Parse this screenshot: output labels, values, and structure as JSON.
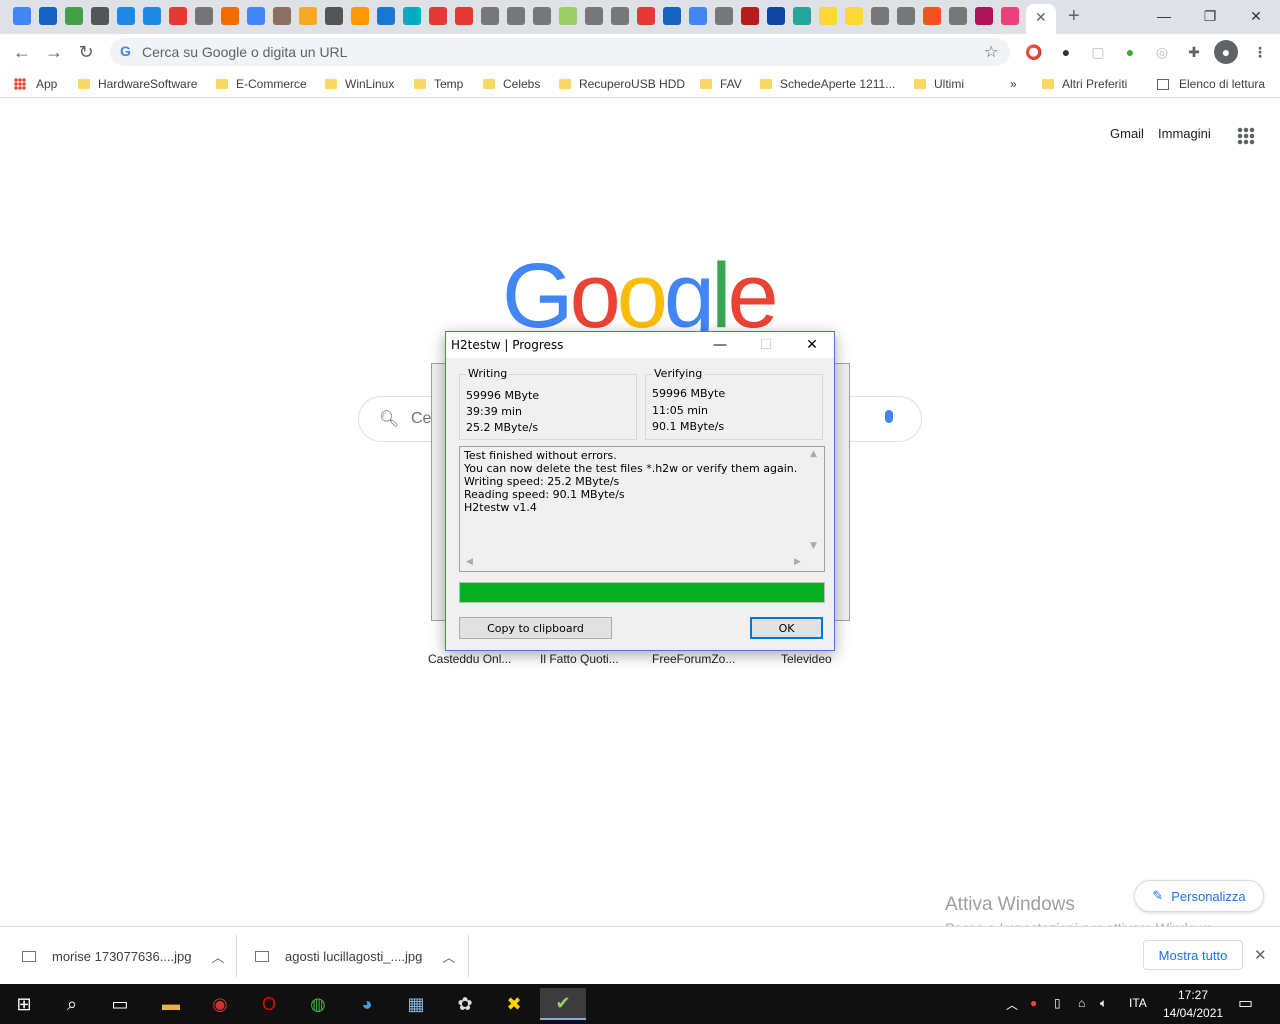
{
  "browser": {
    "omnibox_placeholder": "Cerca su Google o digita un URL",
    "bookmarks": [
      {
        "label": "App",
        "type": "apps"
      },
      {
        "label": "HardwareSoftware",
        "type": "folder"
      },
      {
        "label": "E-Commerce",
        "type": "folder"
      },
      {
        "label": "WinLinux",
        "type": "folder"
      },
      {
        "label": "Temp",
        "type": "folder"
      },
      {
        "label": "Celebs",
        "type": "folder"
      },
      {
        "label": "RecuperoUSB HDD",
        "type": "folder"
      },
      {
        "label": "FAV",
        "type": "folder"
      },
      {
        "label": "SchedeAperte 1211...",
        "type": "folder"
      },
      {
        "label": "Ultimi",
        "type": "folder"
      }
    ],
    "bookmarks_overflow": "»",
    "other_bookmarks": "Altri Preferiti",
    "reading_list": "Elenco di lettura"
  },
  "google": {
    "gmail": "Gmail",
    "images": "Immagini",
    "search_partial": "Ce",
    "shortcuts": [
      "Casteddu Onl...",
      "Il Fatto Quoti...",
      "FreeForumZo...",
      "Televideo"
    ],
    "personalize": "Personalizza"
  },
  "watermark": {
    "line1": "Attiva Windows",
    "line2": "Passa a Impostazioni per attivare Windows."
  },
  "downloads": {
    "items": [
      "morise 173077636....jpg",
      "agosti lucillagosti_....jpg"
    ],
    "show_all": "Mostra tutto"
  },
  "dialog": {
    "title": "H2testw | Progress",
    "writing": {
      "title": "Writing",
      "size": "59996 MByte",
      "time": "39:39 min",
      "speed": "25.2 MByte/s"
    },
    "verifying": {
      "title": "Verifying",
      "size": "59996 MByte",
      "time": "11:05 min",
      "speed": "90.1 MByte/s"
    },
    "log": [
      "Test finished without errors.",
      "You can now delete the test files *.h2w or verify them again.",
      "Writing speed: 25.2 MByte/s",
      "Reading speed: 90.1 MByte/s",
      "H2testw v1.4"
    ],
    "progress": 1.0,
    "copy_button": "Copy to clipboard",
    "ok_button": "OK"
  },
  "taskbar": {
    "language": "ITA",
    "time": "17:27",
    "date": "14/04/2021"
  },
  "colors": {
    "progress_green": "#06b025",
    "google_blue": "#4285f4",
    "google_red": "#ea4335",
    "google_yellow": "#fbbc05",
    "google_green": "#34a853"
  }
}
